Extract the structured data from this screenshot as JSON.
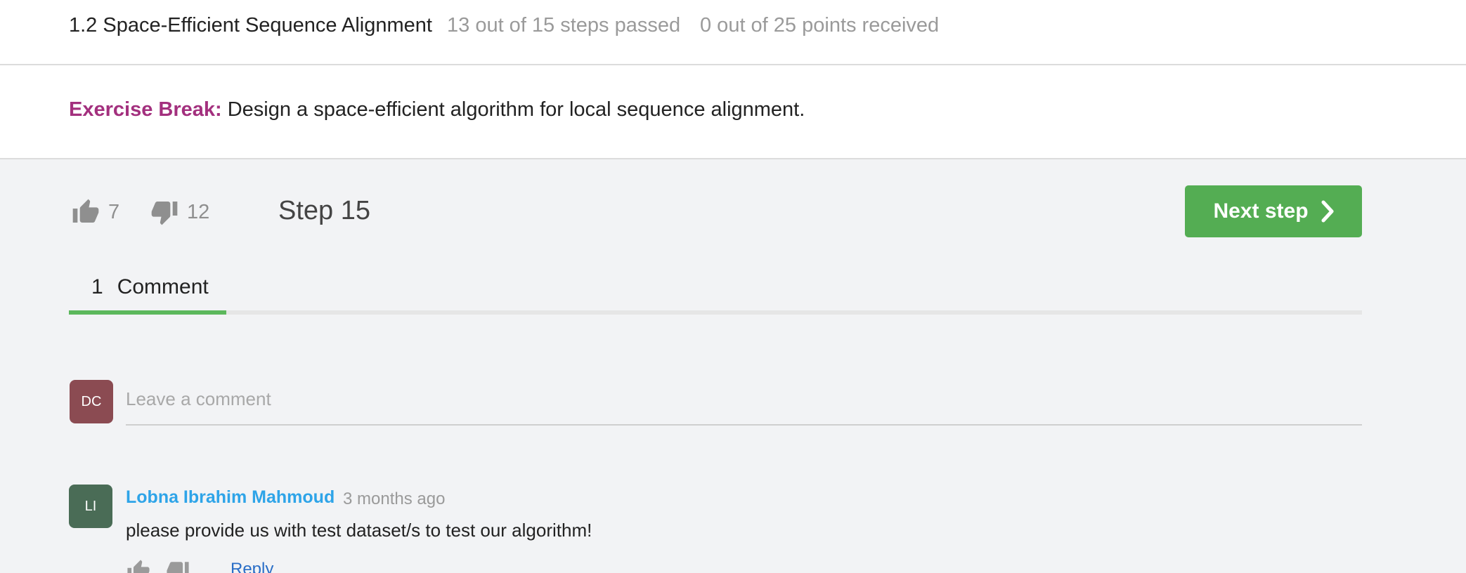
{
  "header": {
    "lesson_title": "1.2 Space-Efficient Sequence Alignment",
    "steps_passed": "13 out of 15 steps passed",
    "points": "0 out of 25 points  received"
  },
  "exercise": {
    "label": "Exercise Break:",
    "text": " Design a space-efficient algorithm for local sequence alignment."
  },
  "step": {
    "likes": "7",
    "dislikes": "12",
    "label": "Step 15",
    "next_label": "Next step"
  },
  "tabs": {
    "count": "1",
    "label": "Comment"
  },
  "comment_form": {
    "avatar_initials": "DC",
    "placeholder": "Leave a comment"
  },
  "comments": [
    {
      "avatar_initials": "LI",
      "author": "Lobna Ibrahim Mahmoud",
      "time": "3 months ago",
      "text": "please provide us with test dataset/s to test our algorithm!",
      "reply_label": "Reply"
    }
  ],
  "icons": {
    "like": "thumbs-up-icon",
    "dislike": "thumbs-down-icon",
    "next": "chevron-right-icon"
  },
  "colors": {
    "exercise_label": "#a3307e",
    "next_button": "#54ad53",
    "active_tab": "#5cb85c",
    "author_link": "#2ea4e8",
    "reply_link": "#2a6ec7"
  }
}
